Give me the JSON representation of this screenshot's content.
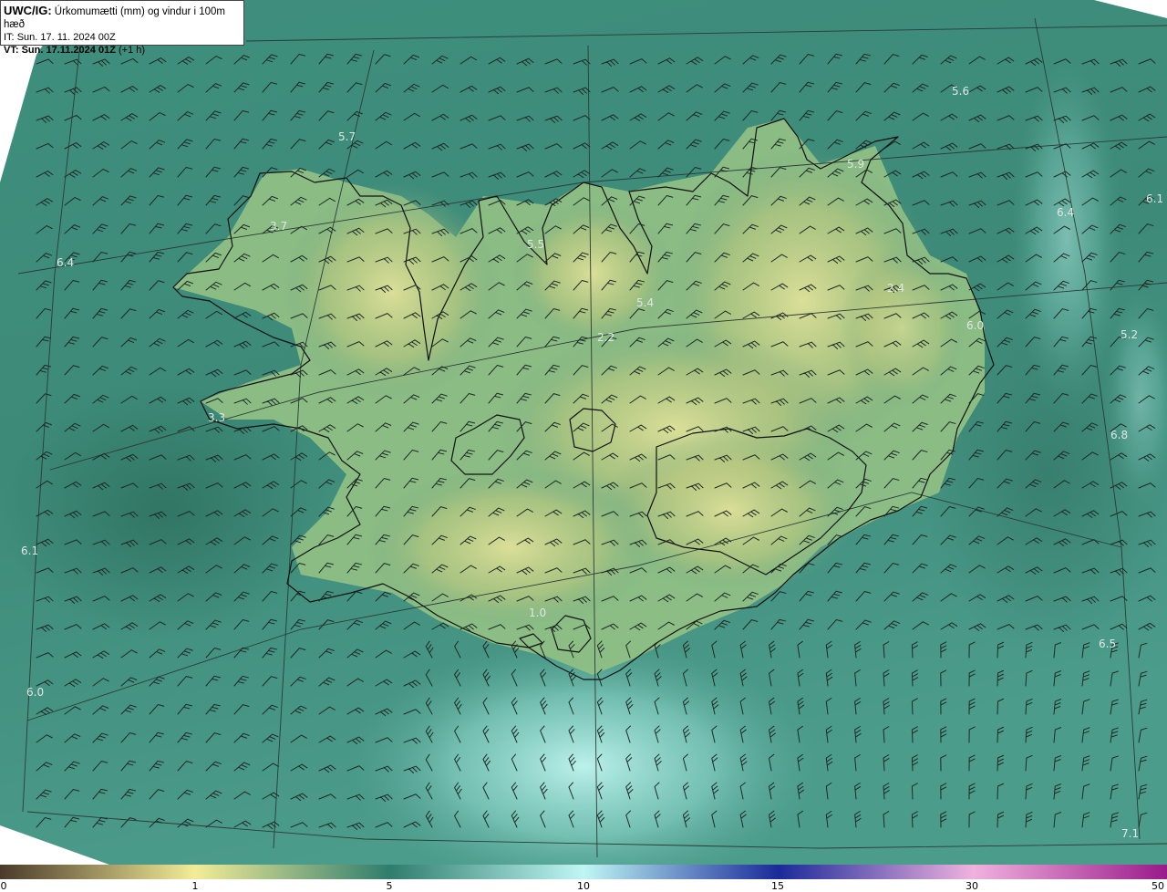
{
  "header": {
    "product_code": "UWC/IG:",
    "product_title": "Úrkomumætti (mm) og vindur i 100m hæð",
    "it_label": "IT:",
    "it_value": "Sun. 17. 11. 2024 00Z",
    "vt_label": "VT:",
    "vt_value": "Sun. 17.11.2024 01Z",
    "vt_offset": "(+1 h)"
  },
  "map": {
    "labels": [
      "5.6",
      "5.7",
      "5.9",
      "6.1",
      "6.4",
      "3.7",
      "5.5",
      "6.4",
      "5.4",
      "2.4",
      "6.0",
      "5.2",
      "2.2",
      "3.3",
      "6.8",
      "6.1",
      "6.0",
      "6.5",
      "7.1",
      "1.0"
    ],
    "colors": {
      "sea_teal": "#3f8f7e",
      "land_yellow": "#d9dc8e",
      "light_cyan": "#b9f2ec",
      "coastline": "#101010",
      "grid": "#2c3a36",
      "label": "#dfe7e3"
    }
  },
  "colorbar": {
    "ticks": [
      "0",
      "1",
      "5",
      "10",
      "15",
      "30",
      "50"
    ],
    "tick_values": [
      0,
      1,
      5,
      10,
      15,
      30,
      50
    ],
    "colors": {
      "start": "#4a3a2a",
      "one": "#f3ec97",
      "five": "#2f7d6d",
      "ten": "#bff6f4",
      "fifteen": "#1a2a9a",
      "thirty": "#f0b2de",
      "fifty": "#9a1a8a"
    }
  }
}
